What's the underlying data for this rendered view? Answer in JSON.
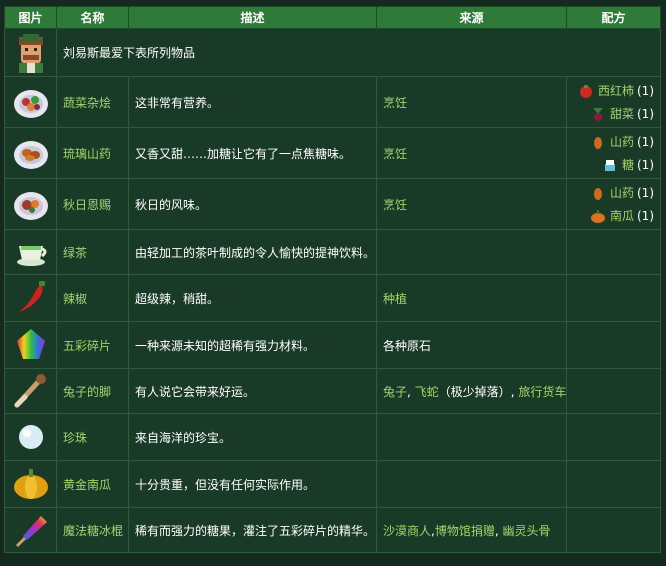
{
  "headers": {
    "image": "图片",
    "name": "名称",
    "desc": "描述",
    "source": "来源",
    "recipe": "配方"
  },
  "intro": {
    "text": "刘易斯最爱下表所列物品",
    "icon": "lewis-portrait-icon"
  },
  "rows": [
    {
      "icon": "vegetable-medley-icon",
      "name": "蔬菜杂烩",
      "desc": "这非常有营养。",
      "source": "烹饪",
      "recipe": [
        {
          "item": "西红柿",
          "qty": "(1)",
          "icon": "tomato-icon"
        },
        {
          "item": "甜菜",
          "qty": "(1)",
          "icon": "beet-icon"
        }
      ]
    },
    {
      "icon": "glazed-yams-icon",
      "name": "琉璃山药",
      "desc": "又香又甜……加糖让它有了一点焦糖味。",
      "source": "烹饪",
      "recipe": [
        {
          "item": "山药",
          "qty": "(1)",
          "icon": "yam-icon"
        },
        {
          "item": "糖",
          "qty": "(1)",
          "icon": "sugar-icon"
        }
      ]
    },
    {
      "icon": "autumns-bounty-icon",
      "name": "秋日恩赐",
      "desc": "秋日的风味。",
      "source": "烹饪",
      "recipe": [
        {
          "item": "山药",
          "qty": "(1)",
          "icon": "yam-icon"
        },
        {
          "item": "南瓜",
          "qty": "(1)",
          "icon": "pumpkin-icon"
        }
      ]
    },
    {
      "icon": "green-tea-icon",
      "name": "绿茶",
      "desc": "由轻加工的茶叶制成的令人愉快的提神饮料。",
      "source": "",
      "recipe": []
    },
    {
      "icon": "hot-pepper-icon",
      "name": "辣椒",
      "desc": "超级辣，稍甜。",
      "source": "种植",
      "recipe": []
    },
    {
      "icon": "prismatic-shard-icon",
      "name": "五彩碎片",
      "desc": "一种来源未知的超稀有强力材料。",
      "source": "各种原石",
      "recipe": []
    },
    {
      "icon": "rabbits-foot-icon",
      "name": "兔子的脚",
      "desc": "有人说它会带来好运。",
      "source": "",
      "recipe": []
    },
    {
      "icon": "pearl-icon",
      "name": "珍珠",
      "desc": "来自海洋的珍宝。",
      "source": "",
      "recipe": []
    },
    {
      "icon": "golden-pumpkin-icon",
      "name": "黄金南瓜",
      "desc": "十分贵重，但没有任何实际作用。",
      "source": "",
      "recipe": []
    },
    {
      "icon": "magic-rock-candy-icon",
      "name": "魔法糖冰棍",
      "desc": "稀有而强力的糖果，灌注了五彩碎片的精华。",
      "source": "",
      "recipe": []
    }
  ],
  "rabbit_sources": {
    "a": "兔子",
    "sep1": ", ",
    "b": "飞蛇",
    "c": "（极少掉落）",
    "sep2": ", ",
    "d": "旅行货车"
  },
  "candy_sources": {
    "a": "沙漠商人",
    "sep1": ",",
    "b": "博物馆捐赠",
    "sep2": ", ",
    "c": "幽灵头骨"
  },
  "colors": {
    "header_bg": "#2e7a38",
    "cell_bg": "#1a3a28",
    "link": "#a4d46a",
    "page_bg": "#142a1e"
  }
}
